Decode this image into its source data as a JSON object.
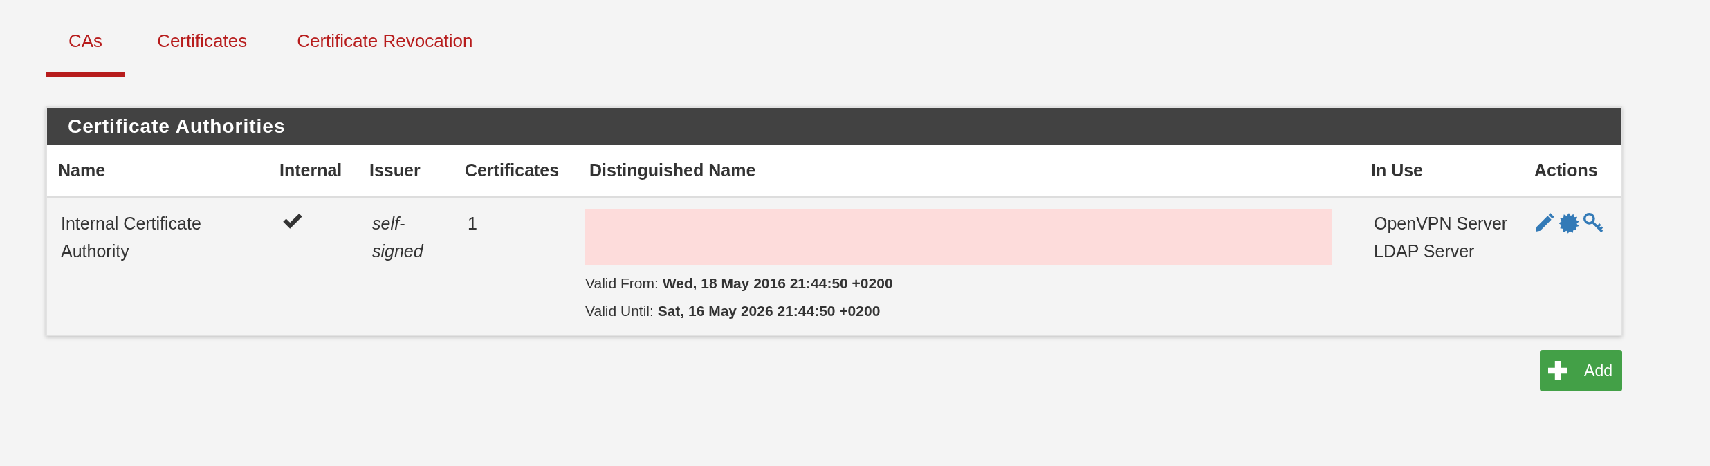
{
  "tabs": [
    {
      "label": "CAs",
      "selected": true
    },
    {
      "label": "Certificates",
      "selected": false
    },
    {
      "label": "Certificate Revocation",
      "selected": false
    }
  ],
  "panel": {
    "title": "Certificate Authorities",
    "columns": [
      "Name",
      "Internal",
      "Issuer",
      "Certificates",
      "Distinguished Name",
      "In Use",
      "Actions"
    ],
    "rows": [
      {
        "name": "Internal Certificate Authority",
        "internal": true,
        "issuer": "self-signed",
        "certificates": "1",
        "valid_from_label": "Valid From:",
        "valid_from": "Wed, 18 May 2016 21:44:50 +0200",
        "valid_until_label": "Valid Until:",
        "valid_until": "Sat, 16 May 2026 21:44:50 +0200",
        "in_use": [
          "OpenVPN Server",
          "LDAP Server"
        ]
      }
    ]
  },
  "add_button": "Add"
}
